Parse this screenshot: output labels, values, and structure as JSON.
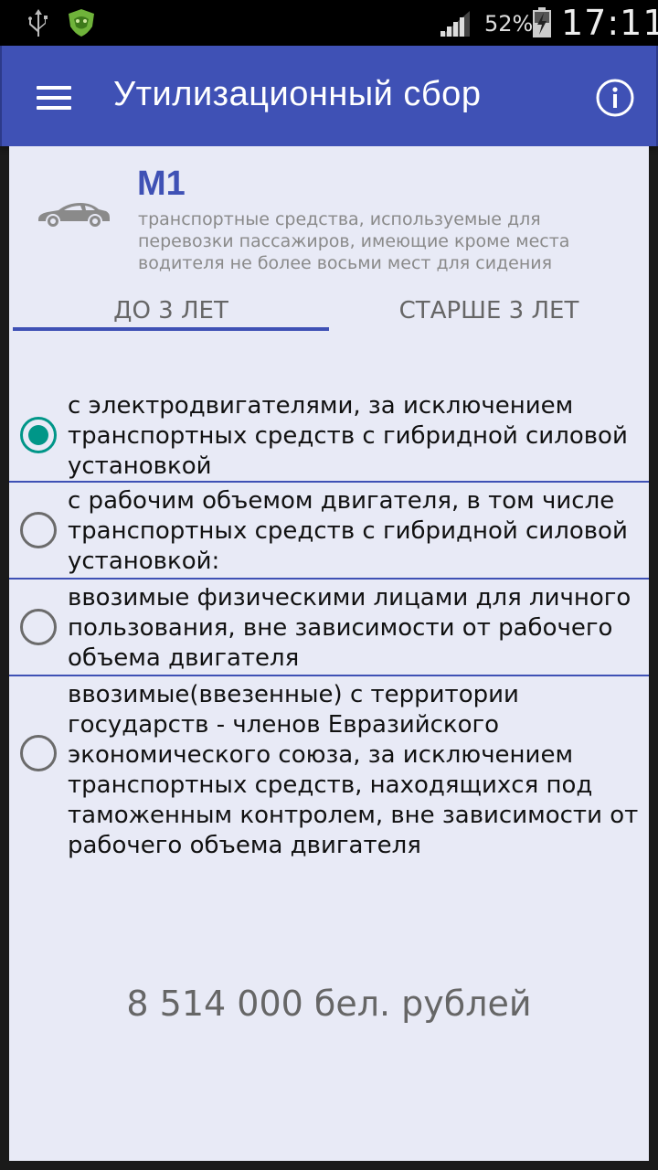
{
  "status_bar": {
    "battery_percent": "52%",
    "time": "17:11",
    "icons": [
      "usb-icon",
      "shield-app-icon",
      "signal-icon",
      "battery-charging-icon"
    ]
  },
  "app_bar": {
    "title": "Утилизационный сбор",
    "menu_icon": "hamburger-menu-icon",
    "info_icon": "info-icon",
    "color": "#3f51b5"
  },
  "category": {
    "code": "M1",
    "icon": "car-icon",
    "description": "транспортные средства, используемые для перевозки пассажиров, имеющие кроме места водителя не более восьми мест для сидения"
  },
  "tabs": [
    {
      "label": "ДО 3 ЛЕТ",
      "selected": true
    },
    {
      "label": "СТАРШЕ 3 ЛЕТ",
      "selected": false
    }
  ],
  "options": [
    {
      "text": "с электродвигателями, за исключением транспортных средств с гибридной силовой установкой",
      "checked": true
    },
    {
      "text": "с рабочим объемом двигателя, в том числе транспортных средств с гибридной силовой установкой:",
      "checked": false
    },
    {
      "text": "ввозимые физическими лицами для личного пользования, вне зависимости от рабочего объема двигателя",
      "checked": false
    },
    {
      "text": "ввозимые(ввезенные) с территории государств - членов Евразийского экономического союза, за исключением транспортных средств, находящихся под таможенным контролем, вне зависимости от рабочего объема двигателя",
      "checked": false
    }
  ],
  "result": "8 514 000 бел. рублей",
  "colors": {
    "accent": "#009688",
    "primary": "#3f51b5",
    "background": "#e8eaf6"
  }
}
